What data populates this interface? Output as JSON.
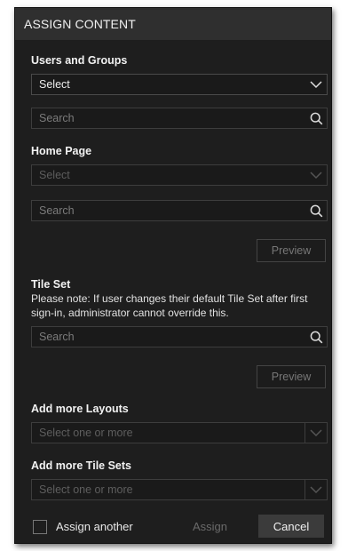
{
  "dialog": {
    "title": "ASSIGN CONTENT"
  },
  "users_groups": {
    "label": "Users and Groups",
    "select_value": "Select",
    "search_placeholder": "Search"
  },
  "home_page": {
    "label": "Home Page",
    "select_value": "Select",
    "search_placeholder": "Search",
    "preview_label": "Preview"
  },
  "tile_set": {
    "label": "Tile Set",
    "note": "Please note: If user changes their default Tile Set after first sign-in, administrator cannot override this.",
    "search_placeholder": "Search",
    "preview_label": "Preview"
  },
  "more_layouts": {
    "label": "Add more Layouts",
    "placeholder": "Select one or more"
  },
  "more_tile_sets": {
    "label": "Add more Tile Sets",
    "placeholder": "Select one or more"
  },
  "footer": {
    "assign_another_label": "Assign another",
    "assign_another_checked": false,
    "assign_label": "Assign",
    "cancel_label": "Cancel"
  },
  "icons": {
    "chevron": "chevron-down-icon",
    "search": "search-icon"
  },
  "colors": {
    "panel_bg": "#1e1e1e",
    "titlebar_bg": "#2f2f2f",
    "cancel_bg": "#3b3b3b"
  }
}
